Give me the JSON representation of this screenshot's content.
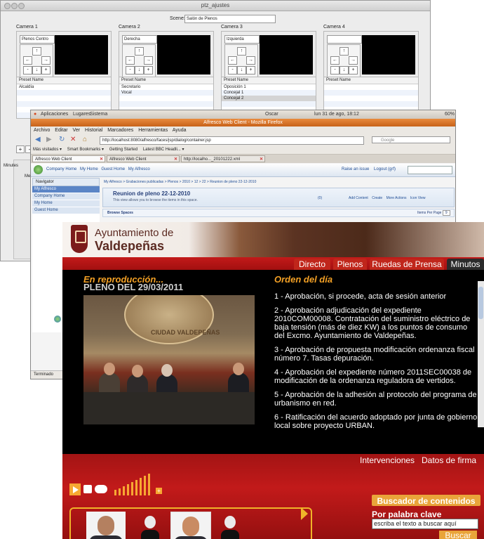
{
  "window1": {
    "title": "ptz_ajustes",
    "scene_label": "Scene:",
    "scene_value": "Salón de Plenos",
    "cameras": [
      {
        "title": "Camera 1",
        "name": "Plenos Centro",
        "presets_header": "Preset Name",
        "presets": [
          "Alcaldía",
          "",
          "",
          "",
          "",
          ""
        ],
        "selected": -1
      },
      {
        "title": "Camera 2",
        "name": "Derecha",
        "presets_header": "Preset Name",
        "presets": [
          "Secretario",
          "Vocal",
          "",
          "",
          "",
          ""
        ],
        "selected": -1
      },
      {
        "title": "Camera 3",
        "name": "Izquierda",
        "presets_header": "Preset Name",
        "presets": [
          "Oposición 1",
          "Concejal 1",
          "Concejal 2",
          "",
          "",
          ""
        ],
        "selected": 2
      },
      {
        "title": "Camera 4",
        "name": "",
        "presets_header": "Preset Name",
        "presets": [
          "",
          "",
          "",
          "",
          "",
          ""
        ],
        "selected": -1
      }
    ],
    "dpad": {
      "up": "↑",
      "left": "←",
      "right": "→",
      "minus": "-",
      "down": "↓",
      "plus": "+"
    },
    "add": "+",
    "remove": "-",
    "tab_minutes": "Minutes",
    "sub_label": "Me"
  },
  "window2": {
    "gnome": {
      "apps": "Aplicaciones",
      "places": "Lugares",
      "system": "Sistema",
      "user": "Oscar",
      "clock": "lun 31 de ago, 18:12",
      "battery": "60%"
    },
    "title": "Alfresco Web Client - Mozilla Firefox",
    "menu": [
      "Archivo",
      "Editar",
      "Ver",
      "Historial",
      "Marcadores",
      "Herramientas",
      "Ayuda"
    ],
    "url": "http://localhost:8080/alfresco/faces/jsp/dialog/container.jsp",
    "search_placeholder": "Google",
    "bookmarks": [
      "Más visitados ▾",
      "Smart Bookmarks ▾",
      "Getting Started",
      "Latest BBC Headli... ▾"
    ],
    "tabs": [
      "Alfresco Web Client",
      "Alfresco Web Client",
      "http://localho..._20101222.xml"
    ],
    "alf_links": [
      "Company Home",
      "My Home",
      "Guest Home",
      "My Alfresco"
    ],
    "alf_right": [
      "Raise an issue",
      "Logout (grf)"
    ],
    "navigator": "Navigator",
    "nav_items": [
      "My Alfresco",
      "Company Home",
      "My Home",
      "Guest Home"
    ],
    "breadcrumb": "My Alfresco > Grabaciones publicadas > Plenos > 2010 > 12 > 22 > Reunion de pleno 22-12-2010",
    "space_title": "Reunion de pleno 22-12-2010",
    "space_sub": "This view allows you to browse the items in this space.",
    "space_count": "(0)",
    "space_actions": [
      "Add Content",
      "Create",
      "More Actions",
      "Icon View"
    ],
    "browse_title": "Browse Spaces",
    "items_per_page": "Items Per Page",
    "items_per_page_value": "9",
    "status": "Terminado"
  },
  "window3": {
    "brand_line1": "Ayuntamiento de",
    "brand_line2": "Valdepeñas",
    "nav": [
      "Directo",
      "Plenos",
      "Ruedas de Prensa",
      "Minutos"
    ],
    "now_playing": "En reproducción...",
    "session": "PLENO DEL 29/03/2011",
    "seal_text": "CIUDAD VALDEPEÑAS",
    "agenda_title": "Orden del día",
    "agenda": [
      "1 - Aprobación, si procede, acta de sesión anterior",
      "2 - Aprobación adjudicación del expediente 2010COM00008. Contratación del suministro eléctrico de baja tensión (más de diez KW) a los puntos de consumo del Excmo. Ayuntamiento de Valdepeñas.",
      "3 - Aprobación de propuesta modificación ordenanza fiscal número 7. Tasas depuración.",
      "4 - Aprobación del expediente número 2011SEC00038 de modificación de la ordenanza reguladora de vertidos.",
      "5 - Aprobación de la adhesión al protocolo del programa de urbanismo en red.",
      "6 - Ratificación del acuerdo adoptado por junta de gobierno local sobre proyecto URBAN."
    ],
    "bottom_tabs": [
      "Intervenciones",
      "Datos de firma"
    ],
    "search_title": "Buscador de contenidos",
    "keyword_label": "Por palabra clave",
    "keyword_value": "escriba el texto a buscar aquí",
    "search_button": "Buscar",
    "volume_plus": "+"
  }
}
